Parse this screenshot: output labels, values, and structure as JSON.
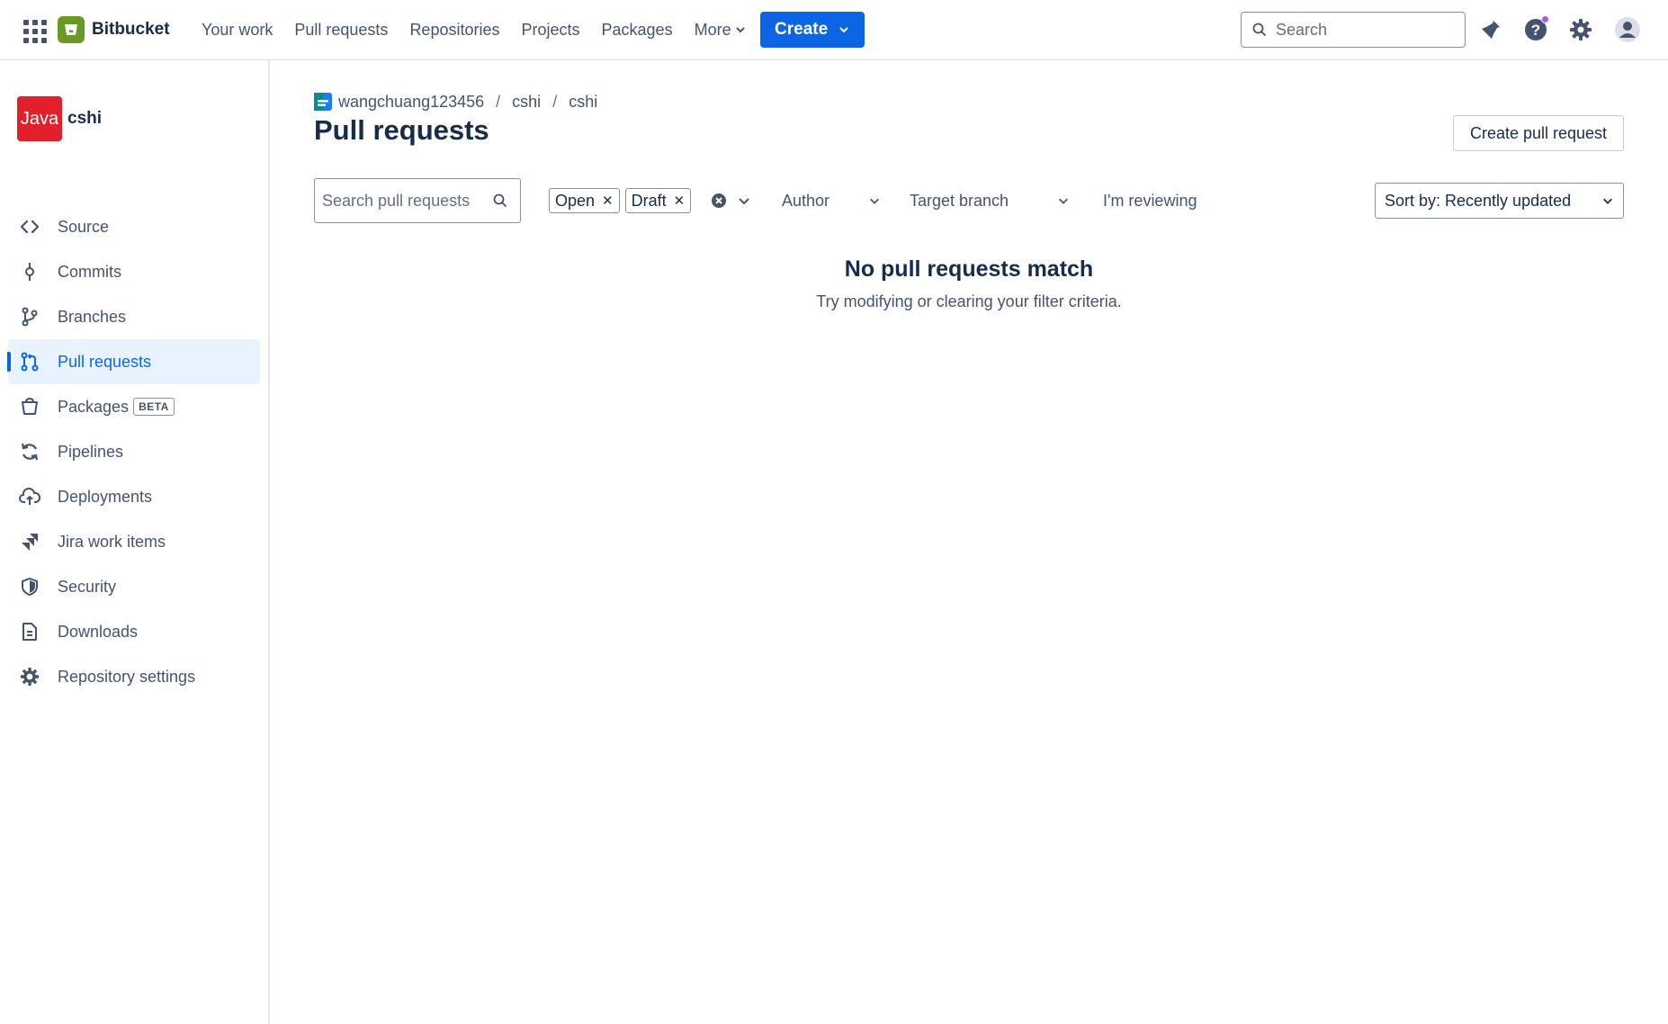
{
  "topbar": {
    "product": "Bitbucket",
    "nav": [
      "Your work",
      "Pull requests",
      "Repositories",
      "Projects",
      "Packages"
    ],
    "more_label": "More",
    "create_label": "Create",
    "search_placeholder": "Search",
    "icons": [
      "app-switcher-icon",
      "notifications-icon",
      "help-icon",
      "settings-icon",
      "profile-icon"
    ],
    "accent": "#0c66e4",
    "notification_dot_color": "#af59e1"
  },
  "sidebar": {
    "repo_avatar_text": "Java",
    "repo_avatar_color": "#e2202b",
    "repo_name": "cshi",
    "items": [
      {
        "label": "Source",
        "icon": "code-icon"
      },
      {
        "label": "Commits",
        "icon": "commit-icon"
      },
      {
        "label": "Branches",
        "icon": "branch-icon"
      },
      {
        "label": "Pull requests",
        "icon": "pull-request-icon",
        "active": true
      },
      {
        "label": "Packages",
        "icon": "package-icon",
        "badge": "BETA"
      },
      {
        "label": "Pipelines",
        "icon": "pipelines-icon"
      },
      {
        "label": "Deployments",
        "icon": "cloud-upload-icon"
      },
      {
        "label": "Jira work items",
        "icon": "jira-icon"
      },
      {
        "label": "Security",
        "icon": "shield-icon"
      },
      {
        "label": "Downloads",
        "icon": "download-file-icon"
      },
      {
        "label": "Repository settings",
        "icon": "gear-icon"
      }
    ]
  },
  "main": {
    "breadcrumb": [
      "wangchuang123456",
      "cshi",
      "cshi"
    ],
    "title": "Pull requests",
    "create_pr_label": "Create pull request",
    "search_placeholder": "Search pull requests",
    "state_filters": [
      "Open",
      "Draft"
    ],
    "author_label": "Author",
    "target_branch_label": "Target branch",
    "reviewing_label": "I'm reviewing",
    "sort_label": "Sort by: Recently updated",
    "empty_title": "No pull requests match",
    "empty_subtitle": "Try modifying or clearing your filter criteria."
  }
}
